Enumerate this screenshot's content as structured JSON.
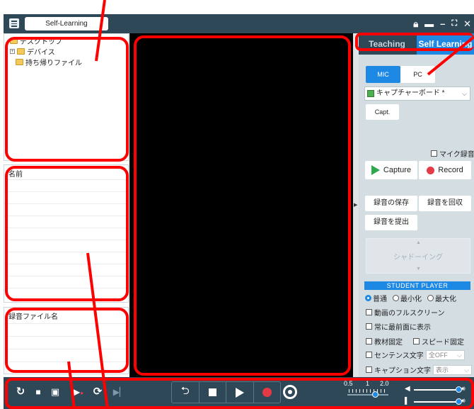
{
  "titlebar": {
    "title": "Self-Learning",
    "icons": [
      "lock-icon",
      "minimize-bar-icon",
      "minimize-icon",
      "maximize-icon",
      "close-icon"
    ]
  },
  "tree": {
    "items": [
      "デスクトップ",
      "デバイス",
      "持ち帰りファイル"
    ]
  },
  "names_panel": {
    "header": "名前"
  },
  "recordings_panel": {
    "header": "録音ファイル名"
  },
  "right_panel": {
    "tabs": [
      "Teaching",
      "Self Learning"
    ],
    "active_tab": "Self Learning",
    "mic_label": "MIC",
    "pc_label": "PC",
    "device_select": "キャプチャーボード *",
    "capt_label": "Capt.",
    "mic_record_label": "マイク録音",
    "capture_label": "Capture",
    "record_label": "Record",
    "save_recording_label": "録音の保存",
    "collect_recording_label": "録音を回収",
    "submit_recording_label": "録音を提出",
    "shadowing_label": "シャドーイング",
    "student_player_header": "STUDENT PLAYER",
    "radio_options": [
      "普通",
      "最小化",
      "最大化"
    ],
    "selected_radio": "普通",
    "checkbox_options": {
      "fullscreen": "動画のフルスクリーン",
      "always_front": "常に最前面に表示",
      "fix_material": "教材固定",
      "fix_speed": "スピード固定",
      "sentence_text": "センテンス文字",
      "sentence_value": "全OFF",
      "caption_text": "キャプション文字",
      "caption_value": "表示"
    }
  },
  "toolbar": {
    "speed_min": "0.5",
    "speed_mid": "1",
    "speed_max": "2.0",
    "speed_value": 1,
    "volume_level_1": 1.0,
    "volume_level_2": 1.0
  },
  "colors": {
    "dark": "#2f4858",
    "accent": "#1e88e5",
    "record_red": "#e53945",
    "capture_green": "#2fa84f",
    "annotation_red": "#ff0000"
  }
}
